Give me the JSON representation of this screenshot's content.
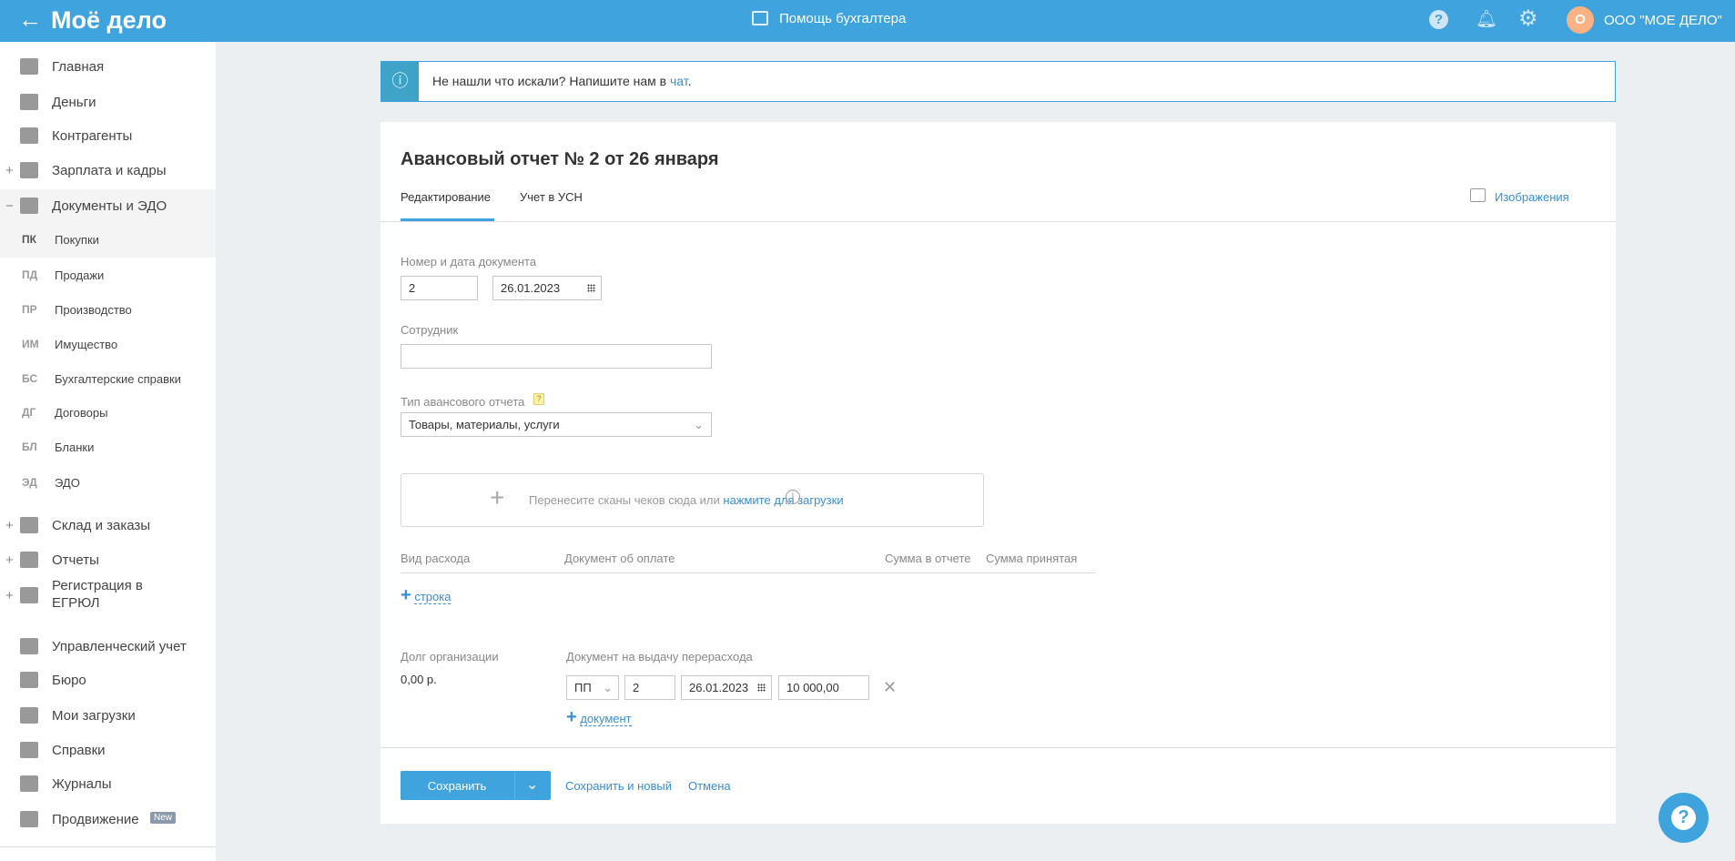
{
  "header": {
    "logo": "Моё дело",
    "helper": "Помощь бухгалтера",
    "org": "ООО \"МОЕ ДЕЛО\"",
    "avatar_letter": "О",
    "brand_color": "#3fa3de"
  },
  "sidebar": {
    "items": [
      {
        "label": "Главная",
        "icon": "home-icon"
      },
      {
        "label": "Деньги",
        "icon": "money-icon"
      },
      {
        "label": "Контрагенты",
        "icon": "contractor-icon"
      },
      {
        "label": "Зарплата и кадры",
        "icon": "wallet-icon",
        "expand": "+"
      },
      {
        "label": "Документы и ЭДО",
        "icon": "folder-icon",
        "expand": "−"
      },
      {
        "label": "Склад и заказы",
        "icon": "warehouse-icon",
        "expand": "+"
      },
      {
        "label": "Отчеты",
        "icon": "report-icon",
        "expand": "+"
      },
      {
        "label": "Регистрация в ЕГРЮЛ",
        "icon": "registration-icon",
        "expand": "+"
      },
      {
        "label": "Управленческий учет",
        "icon": "ruble-icon"
      },
      {
        "label": "Бюро",
        "icon": "briefcase-icon"
      },
      {
        "label": "Мои загрузки",
        "icon": "folder-icon"
      },
      {
        "label": "Справки",
        "icon": "certificate-icon"
      },
      {
        "label": "Журналы",
        "icon": "journal-icon"
      },
      {
        "label": "Продвижение",
        "icon": "chart-icon",
        "badge": "New"
      }
    ],
    "subitems": [
      {
        "abbr": "ПК",
        "label": "Покупки"
      },
      {
        "abbr": "ПД",
        "label": "Продажи"
      },
      {
        "abbr": "ПР",
        "label": "Производство"
      },
      {
        "abbr": "ИМ",
        "label": "Имущество"
      },
      {
        "abbr": "БС",
        "label": "Бухгалтерские справки"
      },
      {
        "abbr": "ДГ",
        "label": "Договоры"
      },
      {
        "abbr": "БЛ",
        "label": "Бланки"
      },
      {
        "abbr": "ЭД",
        "label": "ЭДО"
      }
    ]
  },
  "banner": {
    "text": "Не нашли что искали? Напишите нам в ",
    "link": "чат",
    "end": "."
  },
  "form": {
    "title": "Авансовый отчет № 2 от 26 января",
    "tabs": [
      "Редактирование",
      "Учет в УСН"
    ],
    "images": "Изображения",
    "num_date_label": "Номер и дата документа",
    "number": "2",
    "date": "26.01.2023",
    "employee_label": "Сотрудник",
    "employee": "",
    "type_label": "Тип авансового отчета",
    "type_value": "Товары, материалы, услуги",
    "drop_text": "Перенесите сканы чеков сюда или ",
    "drop_link": "нажмите для загрузки",
    "columns": [
      "Вид расхода",
      "Документ об оплате",
      "Сумма в отчете",
      "Сумма принятая"
    ],
    "add_row": "строка",
    "debt_label": "Долг организации",
    "debt_value": "0,00 р.",
    "overspend_label": "Документ на выдачу перерасхода",
    "overspend": {
      "type": "ПП",
      "number": "2",
      "date": "26.01.2023",
      "amount": "10 000,00"
    },
    "add_doc": "документ",
    "save": "Сохранить",
    "save_new": "Сохранить и новый",
    "cancel": "Отмена"
  }
}
